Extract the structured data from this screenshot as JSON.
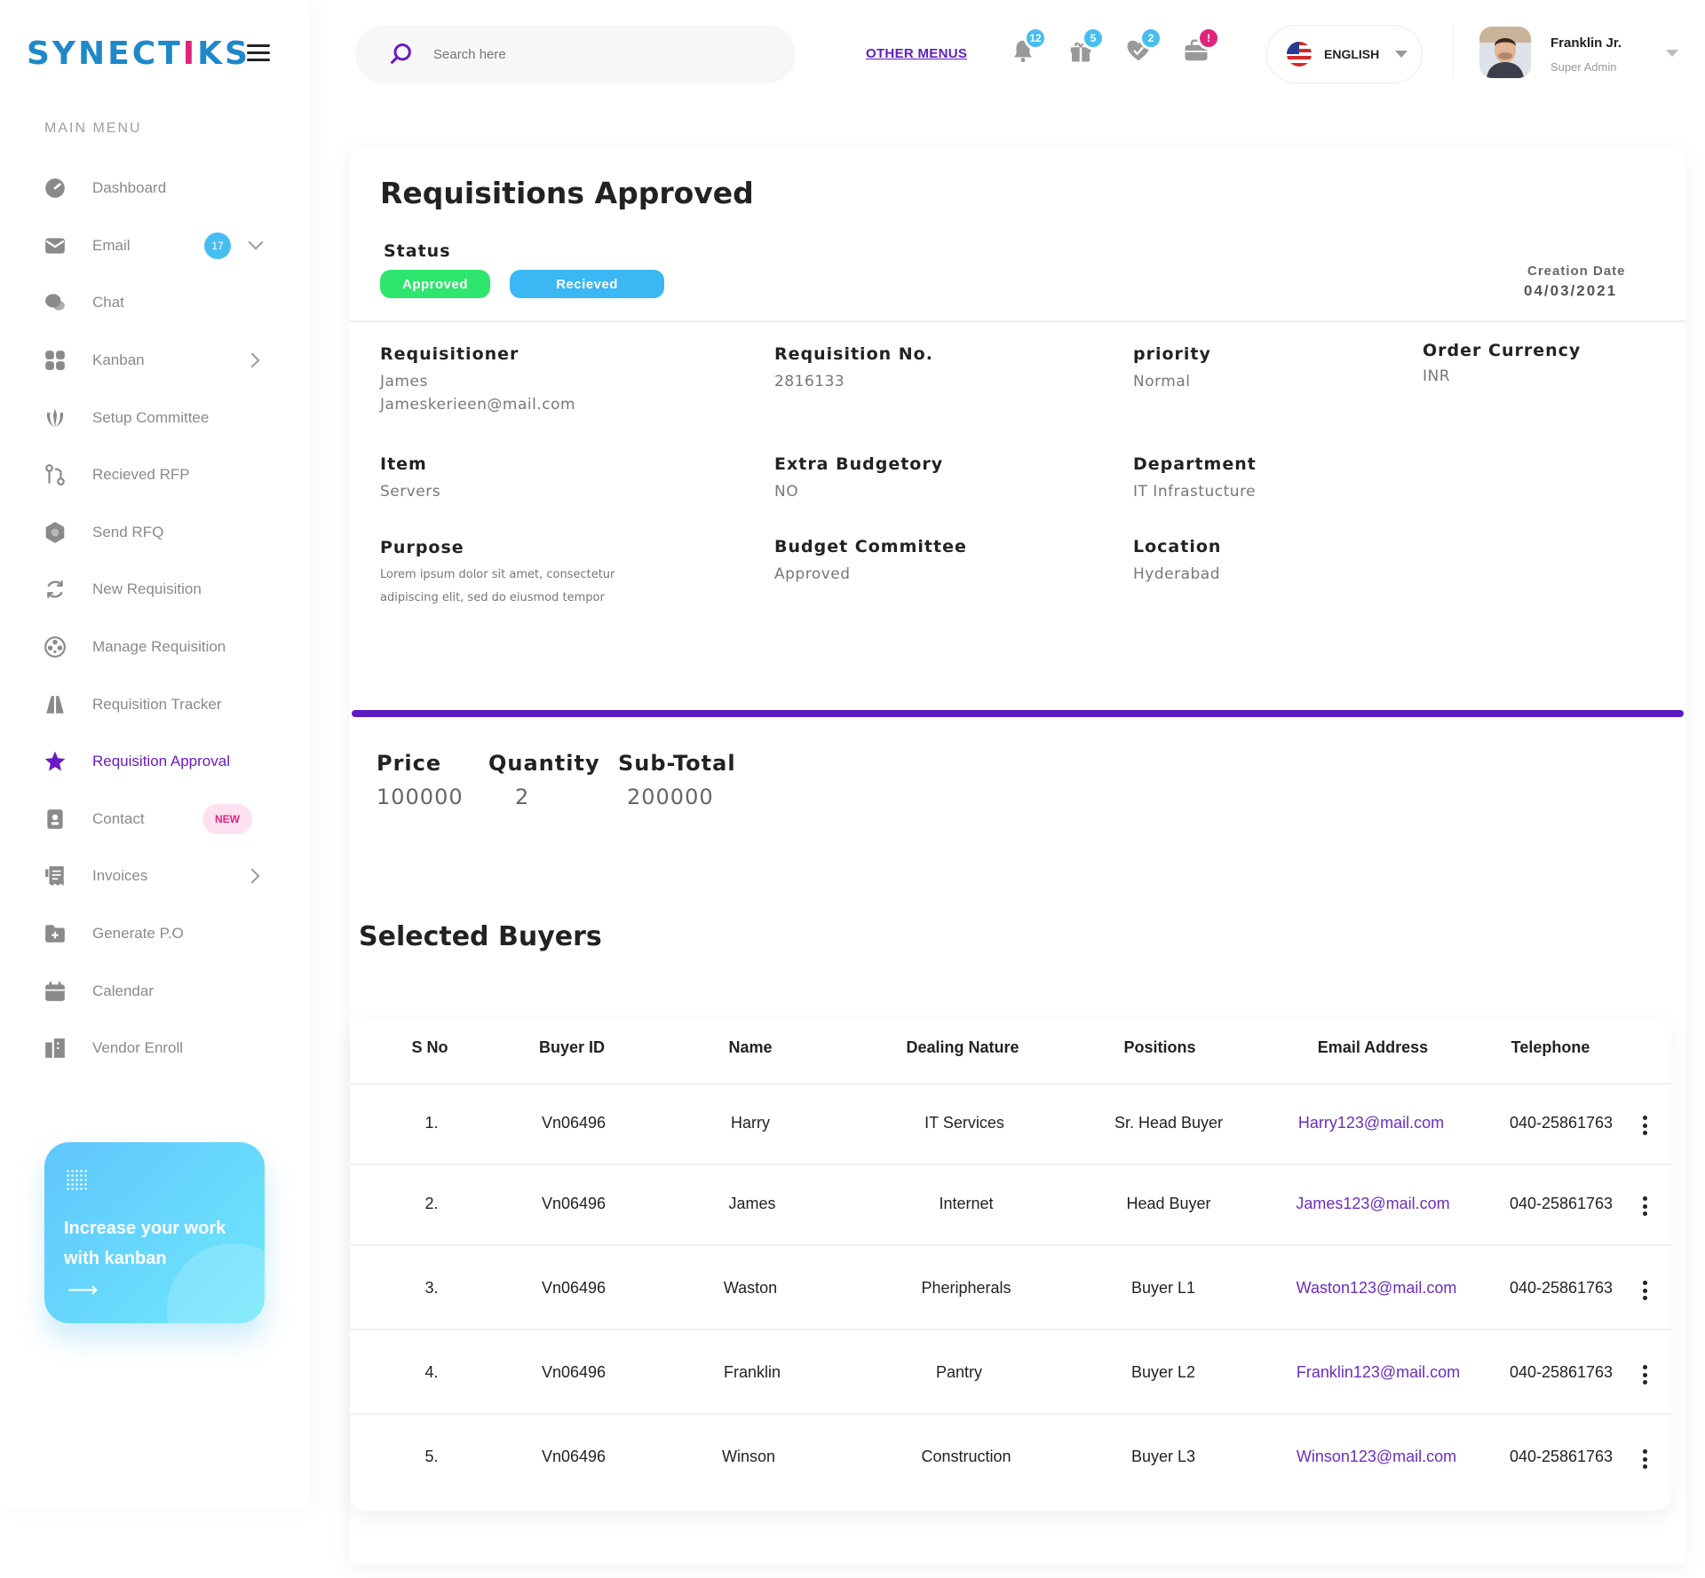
{
  "brand": {
    "logo_pre": "SYNECT",
    "logo_i": "I",
    "logo_post": "KS"
  },
  "sidebar": {
    "menu_title": "MAIN MENU",
    "items": [
      {
        "label": "Dashboard",
        "icon": "gauge-icon"
      },
      {
        "label": "Email",
        "icon": "envelope-icon",
        "badge": "17"
      },
      {
        "label": "Chat",
        "icon": "chat-bubbles-icon"
      },
      {
        "label": "Kanban",
        "icon": "grid-icon"
      },
      {
        "label": "Setup Committee",
        "icon": "emblem-icon"
      },
      {
        "label": "Recieved RFP",
        "icon": "git-pull-icon"
      },
      {
        "label": "Send RFQ",
        "icon": "hexagon-icon"
      },
      {
        "label": "New Requisition",
        "icon": "refresh-icon"
      },
      {
        "label": "Manage Requisition",
        "icon": "aperture-icon"
      },
      {
        "label": "Requisition Tracker",
        "icon": "road-icon"
      },
      {
        "label": "Requisition Approval",
        "icon": "star-icon"
      },
      {
        "label": "Contact",
        "icon": "contact-book-icon",
        "badge": "NEW"
      },
      {
        "label": "Invoices",
        "icon": "receipt-icon"
      },
      {
        "label": "Generate P.O",
        "icon": "folder-plus-icon"
      },
      {
        "label": "Calendar",
        "icon": "calendar-icon"
      },
      {
        "label": "Vendor Enroll",
        "icon": "building-icon"
      }
    ],
    "promo": {
      "text": "Increase your work with kanban",
      "arrow": "⟶"
    }
  },
  "header": {
    "search_placeholder": "Search here",
    "other_menus": "OTHER MENUS",
    "notifications": [
      {
        "icon": "bell-icon",
        "count": "12"
      },
      {
        "icon": "gift-icon",
        "count": "5"
      },
      {
        "icon": "heart-check-icon",
        "count": "2"
      },
      {
        "icon": "briefcase-icon",
        "count": "!"
      }
    ],
    "language": "ENGLISH",
    "user": {
      "name": "Franklin Jr.",
      "role": "Super Admin"
    }
  },
  "requisition": {
    "title": "Requisitions Approved",
    "status_label": "Status",
    "status_approved": "Approved",
    "status_received": "Recieved",
    "creation_date_label": "Creation Date",
    "creation_date": "04/03/2021",
    "requisitioner_label": "Requisitioner",
    "requisitioner_name": "James",
    "requisitioner_email": "Jameskerieen@mail.com",
    "requisition_no_label": "Requisition No.",
    "requisition_no": "2816133",
    "priority_label": "priority",
    "priority": "Normal",
    "currency_label": "Order Currency",
    "currency": "INR",
    "item_label": "Item",
    "item": "Servers",
    "extra_budget_label": "Extra Budgetory",
    "extra_budget": "NO",
    "department_label": "Department",
    "department": "IT Infrastucture",
    "purpose_label": "Purpose",
    "purpose": "Lorem ipsum dolor sit amet, consectetur adipiscing elit, sed do eiusmod tempor",
    "budget_committee_label": "Budget Committee",
    "budget_committee": "Approved",
    "location_label": "Location",
    "location": "Hyderabad",
    "price_label": "Price",
    "price": "100000",
    "quantity_label": "Quantity",
    "quantity": "2",
    "subtotal_label": "Sub-Total",
    "subtotal": "200000"
  },
  "buyers": {
    "title": "Selected Buyers",
    "columns": [
      "S No",
      "Buyer ID",
      "Name",
      "Dealing Nature",
      "Positions",
      "Email Address",
      "Telephone"
    ],
    "rows": [
      {
        "sno": "1.",
        "id": "Vn06496",
        "name": "Harry",
        "nature": "IT Services",
        "position": "Sr. Head Buyer",
        "email": "Harry123@mail.com",
        "phone": "040-25861763"
      },
      {
        "sno": "2.",
        "id": "Vn06496",
        "name": "James",
        "nature": "Internet",
        "position": "Head Buyer",
        "email": "James123@mail.com",
        "phone": "040-25861763"
      },
      {
        "sno": "3.",
        "id": "Vn06496",
        "name": "Waston",
        "nature": "Pheripherals",
        "position": "Buyer L1",
        "email": "Waston123@mail.com",
        "phone": "040-25861763"
      },
      {
        "sno": "4.",
        "id": "Vn06496",
        "name": "Franklin",
        "nature": "Pantry",
        "position": "Buyer L2",
        "email": "Franklin123@mail.com",
        "phone": "040-25861763"
      },
      {
        "sno": "5.",
        "id": "Vn06496",
        "name": "Winson",
        "nature": "Construction",
        "position": "Buyer L3",
        "email": "Winson123@mail.com",
        "phone": "040-25861763"
      }
    ]
  },
  "colors": {
    "accent": "#5e1bc4",
    "brand": "#1f88c9",
    "approved": "#2ee66e",
    "received": "#3bb7f3",
    "email": "#6b2ec2"
  }
}
